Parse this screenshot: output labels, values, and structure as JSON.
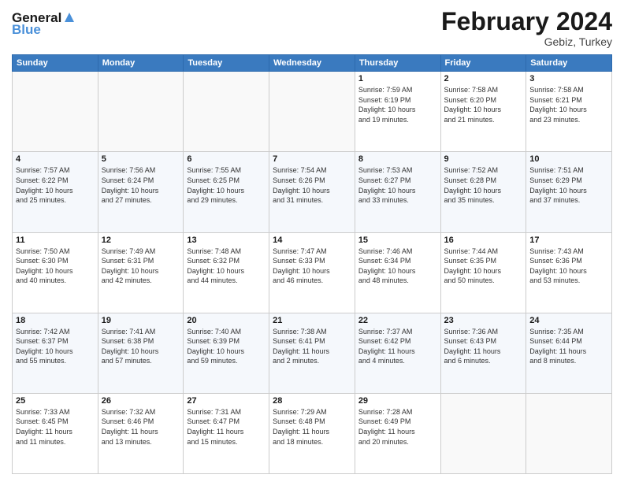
{
  "header": {
    "logo_general": "General",
    "logo_blue": "Blue",
    "month_title": "February 2024",
    "location": "Gebiz, Turkey"
  },
  "days_of_week": [
    "Sunday",
    "Monday",
    "Tuesday",
    "Wednesday",
    "Thursday",
    "Friday",
    "Saturday"
  ],
  "weeks": [
    [
      {
        "day": "",
        "content": ""
      },
      {
        "day": "",
        "content": ""
      },
      {
        "day": "",
        "content": ""
      },
      {
        "day": "",
        "content": ""
      },
      {
        "day": "1",
        "content": "Sunrise: 7:59 AM\nSunset: 6:19 PM\nDaylight: 10 hours\nand 19 minutes."
      },
      {
        "day": "2",
        "content": "Sunrise: 7:58 AM\nSunset: 6:20 PM\nDaylight: 10 hours\nand 21 minutes."
      },
      {
        "day": "3",
        "content": "Sunrise: 7:58 AM\nSunset: 6:21 PM\nDaylight: 10 hours\nand 23 minutes."
      }
    ],
    [
      {
        "day": "4",
        "content": "Sunrise: 7:57 AM\nSunset: 6:22 PM\nDaylight: 10 hours\nand 25 minutes."
      },
      {
        "day": "5",
        "content": "Sunrise: 7:56 AM\nSunset: 6:24 PM\nDaylight: 10 hours\nand 27 minutes."
      },
      {
        "day": "6",
        "content": "Sunrise: 7:55 AM\nSunset: 6:25 PM\nDaylight: 10 hours\nand 29 minutes."
      },
      {
        "day": "7",
        "content": "Sunrise: 7:54 AM\nSunset: 6:26 PM\nDaylight: 10 hours\nand 31 minutes."
      },
      {
        "day": "8",
        "content": "Sunrise: 7:53 AM\nSunset: 6:27 PM\nDaylight: 10 hours\nand 33 minutes."
      },
      {
        "day": "9",
        "content": "Sunrise: 7:52 AM\nSunset: 6:28 PM\nDaylight: 10 hours\nand 35 minutes."
      },
      {
        "day": "10",
        "content": "Sunrise: 7:51 AM\nSunset: 6:29 PM\nDaylight: 10 hours\nand 37 minutes."
      }
    ],
    [
      {
        "day": "11",
        "content": "Sunrise: 7:50 AM\nSunset: 6:30 PM\nDaylight: 10 hours\nand 40 minutes."
      },
      {
        "day": "12",
        "content": "Sunrise: 7:49 AM\nSunset: 6:31 PM\nDaylight: 10 hours\nand 42 minutes."
      },
      {
        "day": "13",
        "content": "Sunrise: 7:48 AM\nSunset: 6:32 PM\nDaylight: 10 hours\nand 44 minutes."
      },
      {
        "day": "14",
        "content": "Sunrise: 7:47 AM\nSunset: 6:33 PM\nDaylight: 10 hours\nand 46 minutes."
      },
      {
        "day": "15",
        "content": "Sunrise: 7:46 AM\nSunset: 6:34 PM\nDaylight: 10 hours\nand 48 minutes."
      },
      {
        "day": "16",
        "content": "Sunrise: 7:44 AM\nSunset: 6:35 PM\nDaylight: 10 hours\nand 50 minutes."
      },
      {
        "day": "17",
        "content": "Sunrise: 7:43 AM\nSunset: 6:36 PM\nDaylight: 10 hours\nand 53 minutes."
      }
    ],
    [
      {
        "day": "18",
        "content": "Sunrise: 7:42 AM\nSunset: 6:37 PM\nDaylight: 10 hours\nand 55 minutes."
      },
      {
        "day": "19",
        "content": "Sunrise: 7:41 AM\nSunset: 6:38 PM\nDaylight: 10 hours\nand 57 minutes."
      },
      {
        "day": "20",
        "content": "Sunrise: 7:40 AM\nSunset: 6:39 PM\nDaylight: 10 hours\nand 59 minutes."
      },
      {
        "day": "21",
        "content": "Sunrise: 7:38 AM\nSunset: 6:41 PM\nDaylight: 11 hours\nand 2 minutes."
      },
      {
        "day": "22",
        "content": "Sunrise: 7:37 AM\nSunset: 6:42 PM\nDaylight: 11 hours\nand 4 minutes."
      },
      {
        "day": "23",
        "content": "Sunrise: 7:36 AM\nSunset: 6:43 PM\nDaylight: 11 hours\nand 6 minutes."
      },
      {
        "day": "24",
        "content": "Sunrise: 7:35 AM\nSunset: 6:44 PM\nDaylight: 11 hours\nand 8 minutes."
      }
    ],
    [
      {
        "day": "25",
        "content": "Sunrise: 7:33 AM\nSunset: 6:45 PM\nDaylight: 11 hours\nand 11 minutes."
      },
      {
        "day": "26",
        "content": "Sunrise: 7:32 AM\nSunset: 6:46 PM\nDaylight: 11 hours\nand 13 minutes."
      },
      {
        "day": "27",
        "content": "Sunrise: 7:31 AM\nSunset: 6:47 PM\nDaylight: 11 hours\nand 15 minutes."
      },
      {
        "day": "28",
        "content": "Sunrise: 7:29 AM\nSunset: 6:48 PM\nDaylight: 11 hours\nand 18 minutes."
      },
      {
        "day": "29",
        "content": "Sunrise: 7:28 AM\nSunset: 6:49 PM\nDaylight: 11 hours\nand 20 minutes."
      },
      {
        "day": "",
        "content": ""
      },
      {
        "day": "",
        "content": ""
      }
    ]
  ]
}
